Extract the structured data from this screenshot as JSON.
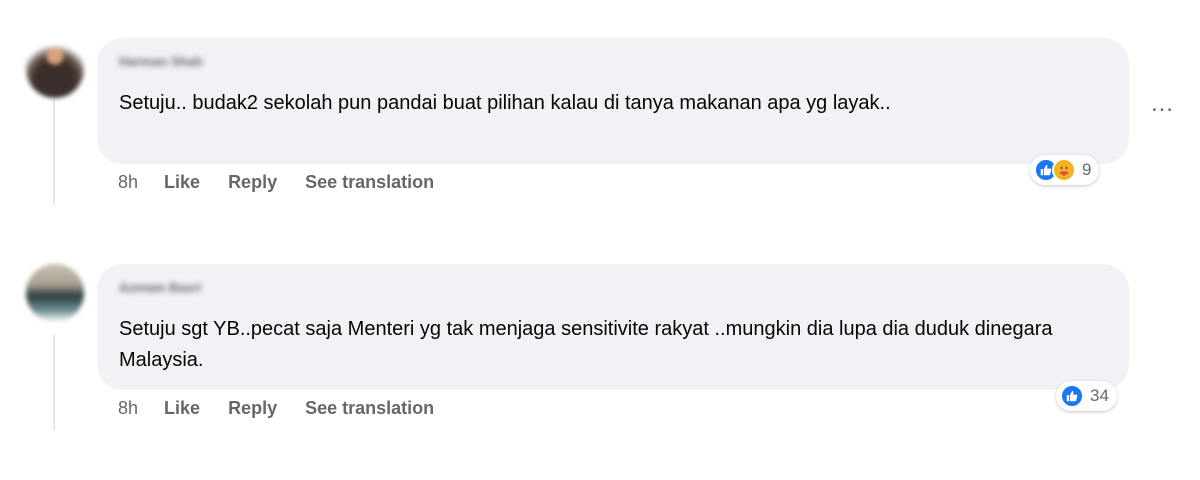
{
  "comments": [
    {
      "author": "Harman Shah",
      "text": "Setuju.. budak2 sekolah pun pandai buat pilihan kalau di tanya makanan apa yg layak..",
      "time": "8h",
      "like_label": "Like",
      "reply_label": "Reply",
      "translate_label": "See translation",
      "reactions": {
        "icons": [
          "like-icon",
          "care-icon"
        ],
        "count": "9"
      },
      "more_icon": "…"
    },
    {
      "author": "Azmam Basri",
      "text": "Setuju sgt YB..pecat saja Menteri yg tak menjaga sensitivite rakyat ..mungkin dia lupa dia duduk dinegara Malaysia.",
      "time": "8h",
      "like_label": "Like",
      "reply_label": "Reply",
      "translate_label": "See translation",
      "reactions": {
        "icons": [
          "like-icon"
        ],
        "count": "34"
      }
    }
  ],
  "colors": {
    "bubble": "#f0f2f5",
    "meta_text": "#65676b",
    "like_blue": "#1877f2",
    "care_yellow": "#f7b125"
  }
}
